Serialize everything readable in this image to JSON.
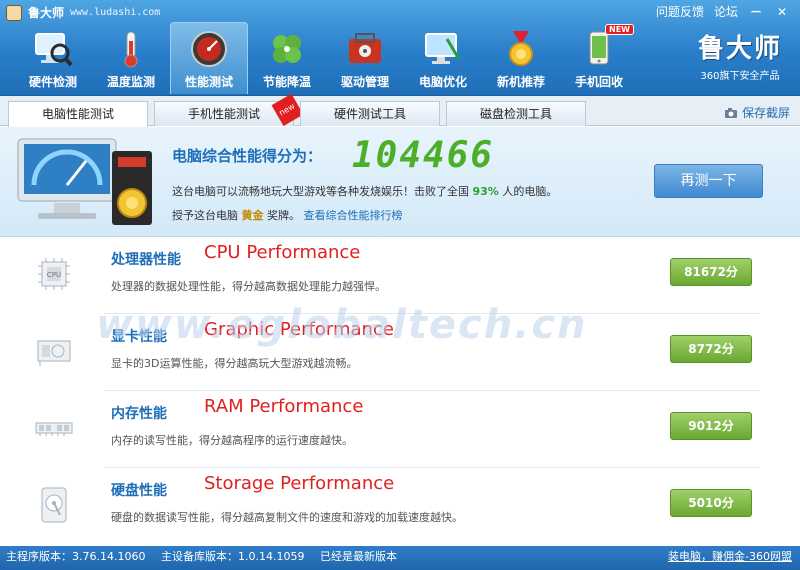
{
  "app": {
    "name": "鲁大师",
    "url": "www.ludashi.com"
  },
  "window_links": {
    "feedback": "问题反馈",
    "forum": "论坛",
    "min": "－",
    "close": "✕"
  },
  "nav": [
    {
      "label": "硬件检测",
      "icon": "monitor-magnifier-icon"
    },
    {
      "label": "温度监测",
      "icon": "thermometer-icon"
    },
    {
      "label": "性能测试",
      "icon": "speedometer-icon",
      "active": true
    },
    {
      "label": "节能降温",
      "icon": "clover-icon"
    },
    {
      "label": "驱动管理",
      "icon": "chip-toolbox-icon"
    },
    {
      "label": "电脑优化",
      "icon": "screen-broom-icon"
    },
    {
      "label": "新机推荐",
      "icon": "medal-icon"
    },
    {
      "label": "手机回收",
      "icon": "phone-recycle-icon",
      "badge": "NEW"
    }
  ],
  "brand": {
    "logo_text": "鲁大师",
    "slogan": "360旗下安全产品"
  },
  "tabs": [
    {
      "label": "电脑性能测试",
      "active": true
    },
    {
      "label": "手机性能测试",
      "tag": "new"
    },
    {
      "label": "硬件测试工具"
    },
    {
      "label": "磁盘检测工具"
    }
  ],
  "save_screenshot": "保存截屏",
  "summary": {
    "label": "电脑综合性能得分为：",
    "score": "104466",
    "desc_prefix": "这台电脑可以流畅地玩大型游戏等各种发烧娱乐！击败了全国",
    "percent": "93%",
    "desc_suffix": "人的电脑。",
    "award_prefix": "授予这台电脑",
    "award": "黄金",
    "award_suffix": "奖牌。",
    "ranking_link": "查看综合性能排行榜",
    "retest": "再测一下"
  },
  "rows": [
    {
      "title": "处理器性能",
      "translation": "CPU Performance",
      "desc": "处理器的数据处理性能，得分越高数据处理能力越强悍。",
      "score": "81672分",
      "icon": "cpu-icon"
    },
    {
      "title": "显卡性能",
      "translation": "Graphic Performance",
      "desc": "显卡的3D运算性能，得分越高玩大型游戏越流畅。",
      "score": "8772分",
      "icon": "graphics-card-icon"
    },
    {
      "title": "内存性能",
      "translation": "RAM Performance",
      "desc": "内存的读写性能，得分越高程序的运行速度越快。",
      "score": "9012分",
      "icon": "ram-stick-icon"
    },
    {
      "title": "硬盘性能",
      "translation": "Storage Performance",
      "desc": "硬盘的数据读写性能，得分越高复制文件的速度和游戏的加载速度越快。",
      "score": "5010分",
      "icon": "hard-disk-icon"
    }
  ],
  "watermark": "www.eglobaltech.cn",
  "status": {
    "main_version": "主程序版本：3.76.14.1060",
    "db_version": "主设备库版本：1.0.14.1059",
    "latest": "已经是最新版本",
    "right_link": "装电脑，赚佣金-360网盟"
  }
}
